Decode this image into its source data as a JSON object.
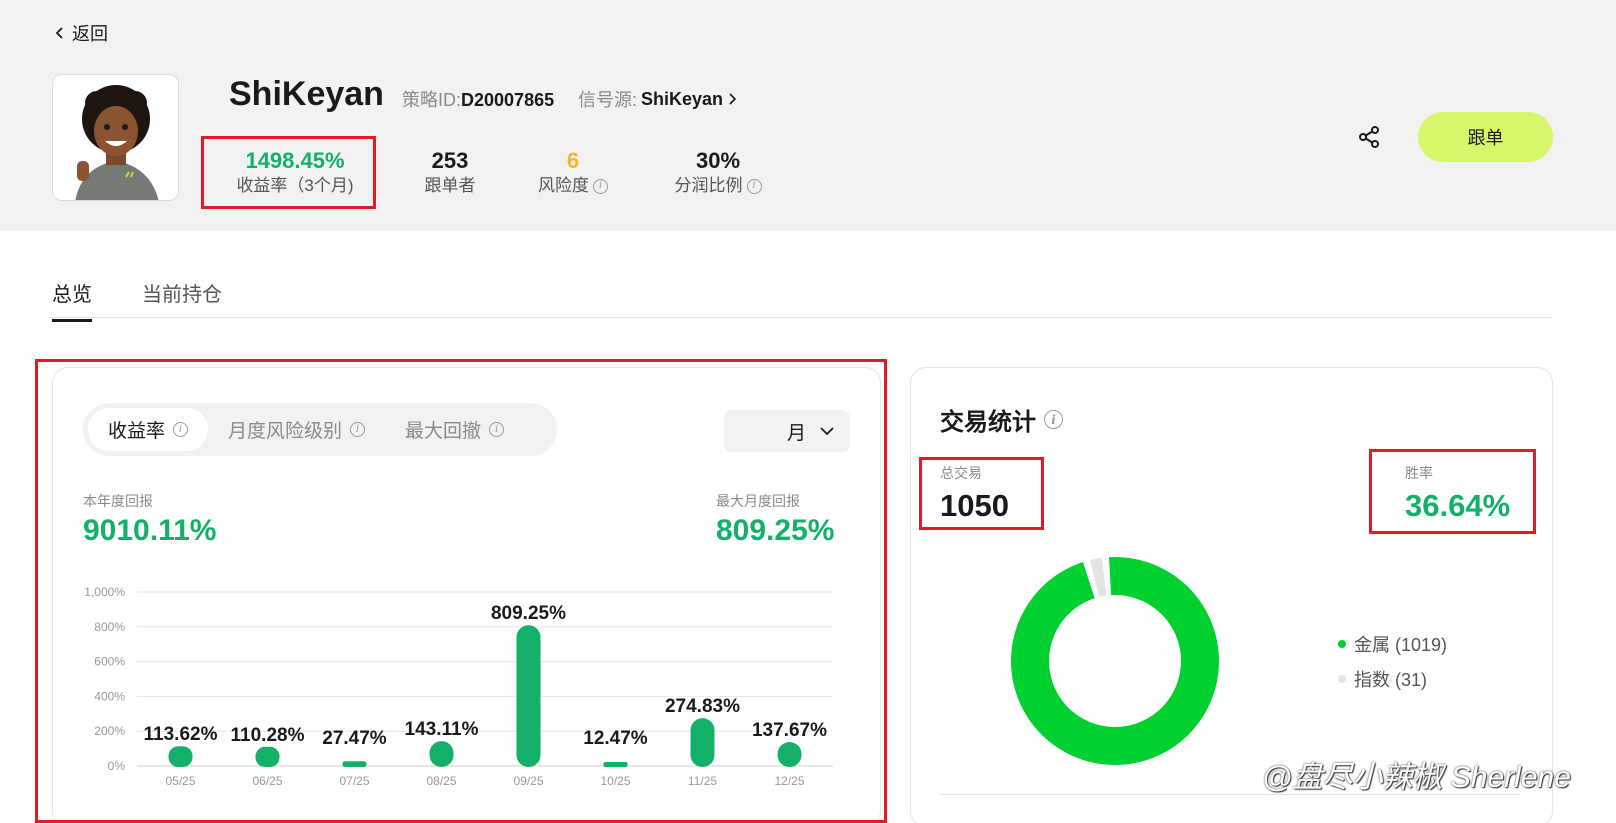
{
  "nav": {
    "back_label": "返回"
  },
  "profile": {
    "name": "ShiKeyan",
    "strategy_prefix": "策略ID:",
    "strategy_id": "D20007865",
    "signal_prefix": "信号源:",
    "signal_name": "ShiKeyan"
  },
  "stats": [
    {
      "value": "1498.45%",
      "label": "收益率（3个月)",
      "color": "#14b06a"
    },
    {
      "value": "253",
      "label": "跟单者",
      "color": "#1a1a1a"
    },
    {
      "value": "6",
      "label": "风险度",
      "color": "#f5b524"
    },
    {
      "value": "30%",
      "label": "分润比例",
      "color": "#1a1a1a"
    }
  ],
  "actions": {
    "follow_label": "跟单"
  },
  "tabs": [
    {
      "label": "总览"
    },
    {
      "label": "当前持仓"
    }
  ],
  "overview": {
    "segments": [
      {
        "label": "收益率"
      },
      {
        "label": "月度风险级别"
      },
      {
        "label": "最大回撤"
      }
    ],
    "period_label": "月",
    "ytd_label": "本年度回报",
    "ytd_value": "9010.11%",
    "max_month_label": "最大月度回报",
    "max_month_value": "809.25%"
  },
  "chart_data": {
    "type": "bar",
    "categories": [
      "05/25",
      "06/25",
      "07/25",
      "08/25",
      "09/25",
      "10/25",
      "11/25",
      "12/25"
    ],
    "values": [
      113.62,
      110.28,
      27.47,
      143.11,
      809.25,
      12.47,
      274.83,
      137.67
    ],
    "data_labels": [
      "113.62%",
      "110.28%",
      "27.47%",
      "143.11%",
      "809.25%",
      "12.47%",
      "274.83%",
      "137.67%"
    ],
    "ylim": [
      0,
      1000
    ],
    "yticks": [
      0,
      200,
      400,
      600,
      800,
      1000
    ],
    "ytick_labels": [
      "0%",
      "200%",
      "400%",
      "600%",
      "800%",
      "1,000%"
    ],
    "grid": true,
    "bar_color": "#14b06a"
  },
  "trade_stats": {
    "title": "交易统计",
    "total_label": "总交易",
    "total_value": "1050",
    "winrate_label": "胜率",
    "winrate_value": "36.64%",
    "breakdown": [
      {
        "label": "金属 (1019)",
        "count": 1019,
        "color": "#00d130"
      },
      {
        "label": "指数 (31)",
        "count": 31,
        "color": "#e4e4e4"
      }
    ]
  },
  "watermark": "@盘尽小辣椒 Sherlene"
}
